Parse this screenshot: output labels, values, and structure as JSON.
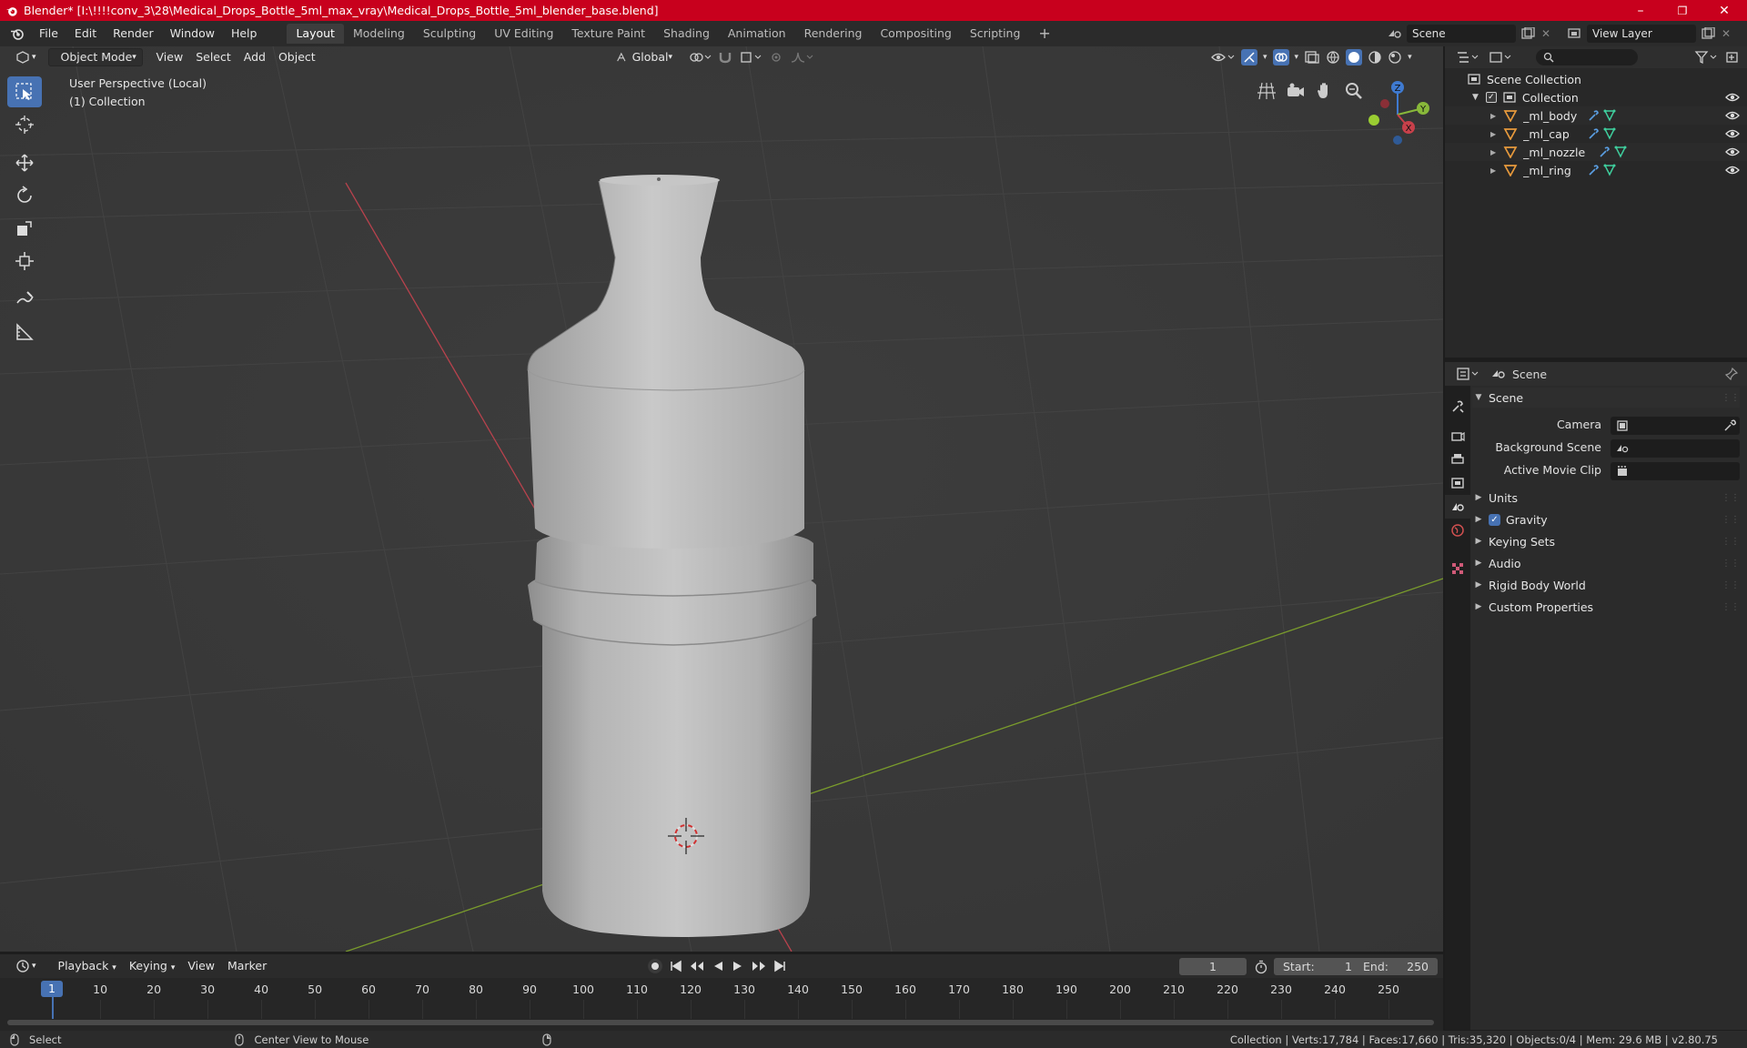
{
  "title_bar": {
    "text": "Blender* [I:\\!!!!conv_3\\28\\Medical_Drops_Bottle_5ml_max_vray\\Medical_Drops_Bottle_5ml_blender_base.blend]",
    "minimize_glyph": "–",
    "maximize_glyph": "❐",
    "close_glyph": "✕"
  },
  "menu": {
    "items": [
      "File",
      "Edit",
      "Render",
      "Window",
      "Help"
    ],
    "workspaces": [
      "Layout",
      "Modeling",
      "Sculpting",
      "UV Editing",
      "Texture Paint",
      "Shading",
      "Animation",
      "Rendering",
      "Compositing",
      "Scripting"
    ],
    "active_workspace": "Layout",
    "add_tab_glyph": "+",
    "scene_name": "Scene",
    "view_layer": "View Layer"
  },
  "viewport": {
    "mode": "Object Mode",
    "menus": [
      "View",
      "Select",
      "Add",
      "Object"
    ],
    "orientation": "Global",
    "perspective_label": "User Perspective (Local)",
    "collection_label": "(1) Collection",
    "gizmo": {
      "x": "X",
      "y": "Y",
      "z": "Z"
    }
  },
  "outliner": {
    "root": "Scene Collection",
    "collection": "Collection",
    "objects": [
      "_ml_body",
      "_ml_cap",
      "_ml_nozzle",
      "_ml_ring"
    ]
  },
  "properties": {
    "context": "Scene",
    "section": "Scene",
    "fields": {
      "camera_label": "Camera",
      "background_scene_label": "Background Scene",
      "active_movie_clip_label": "Active Movie Clip"
    },
    "panels": [
      "Units",
      "Gravity",
      "Keying Sets",
      "Audio",
      "Rigid Body World",
      "Custom Properties"
    ],
    "gravity_checked": true
  },
  "timeline": {
    "menus": [
      "Playback",
      "Keying",
      "View",
      "Marker"
    ],
    "current_frame": "1",
    "start_label": "Start:",
    "start_value": "1",
    "end_label": "End:",
    "end_value": "250",
    "ticks": [
      "10",
      "20",
      "30",
      "40",
      "50",
      "60",
      "70",
      "80",
      "90",
      "100",
      "110",
      "120",
      "130",
      "140",
      "150",
      "160",
      "170",
      "180",
      "190",
      "200",
      "210",
      "220",
      "230",
      "240",
      "250"
    ]
  },
  "status_bar": {
    "left_action": "Select",
    "middle_action": "Center View to Mouse",
    "stats": "Collection | Verts:17,784 | Faces:17,660 | Tris:35,320 | Objects:0/4 | Mem: 29.6 MB | v2.80.75"
  },
  "colors": {
    "title_bar": "#c8001d",
    "accent": "#4772b3",
    "viewport_bg": "#393939",
    "axis_x": "#c7404a",
    "axis_y": "#88b83a",
    "axis_z": "#3f7ad0"
  }
}
